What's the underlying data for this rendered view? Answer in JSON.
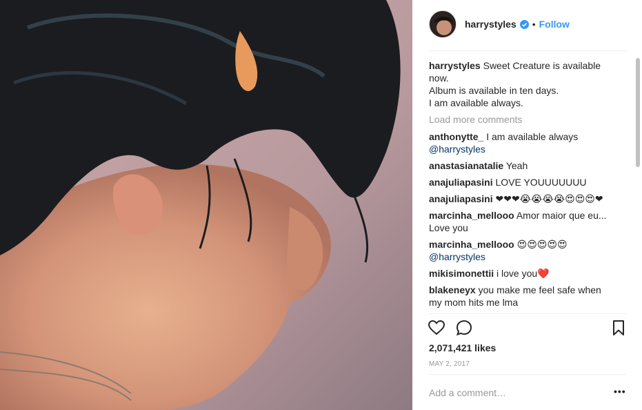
{
  "post": {
    "photo_icon": "post-photo",
    "colors": {
      "link": "#3897f0",
      "mention": "#003569",
      "muted": "#999999",
      "heart": "#ed4956"
    }
  },
  "header": {
    "username": "harrystyles",
    "verified_icon": "verified-badge-icon",
    "separator": "•",
    "follow_label": "Follow"
  },
  "caption": {
    "username": "harrystyles",
    "lines": [
      "Sweet Creature is available now.",
      "Album is available in ten days.",
      "I am available always."
    ]
  },
  "load_more_label": "Load more comments",
  "comments": [
    {
      "user": "anthonytte_",
      "text": "I am available always",
      "mention": "@harrystyles"
    },
    {
      "user": "anastasianatalie",
      "text": "Yeah"
    },
    {
      "user": "anajuliapasini",
      "text": "LOVE YOUUUUUUU"
    },
    {
      "user": "anajuliapasini",
      "text": "❤❤❤😭😭😭😭😍😍😍❤"
    },
    {
      "user": "marcinha_mellooo",
      "text": "Amor maior que eu... Love you"
    },
    {
      "user": "marcinha_mellooo",
      "text": "😍😍😍😍😍",
      "mention": "@harrystyles"
    },
    {
      "user": "mikisimonettii",
      "text": "i love you❤️"
    },
    {
      "user": "blakeneyx",
      "text": "you make me feel safe when my mom hits me lma"
    }
  ],
  "actions": {
    "like_icon": "heart-icon",
    "comment_icon": "comment-icon",
    "save_icon": "bookmark-icon"
  },
  "likes_label": "2,071,421 likes",
  "date_label": "MAY 2, 2017",
  "comment_box": {
    "placeholder": "Add a comment…",
    "more_label": "•••"
  }
}
